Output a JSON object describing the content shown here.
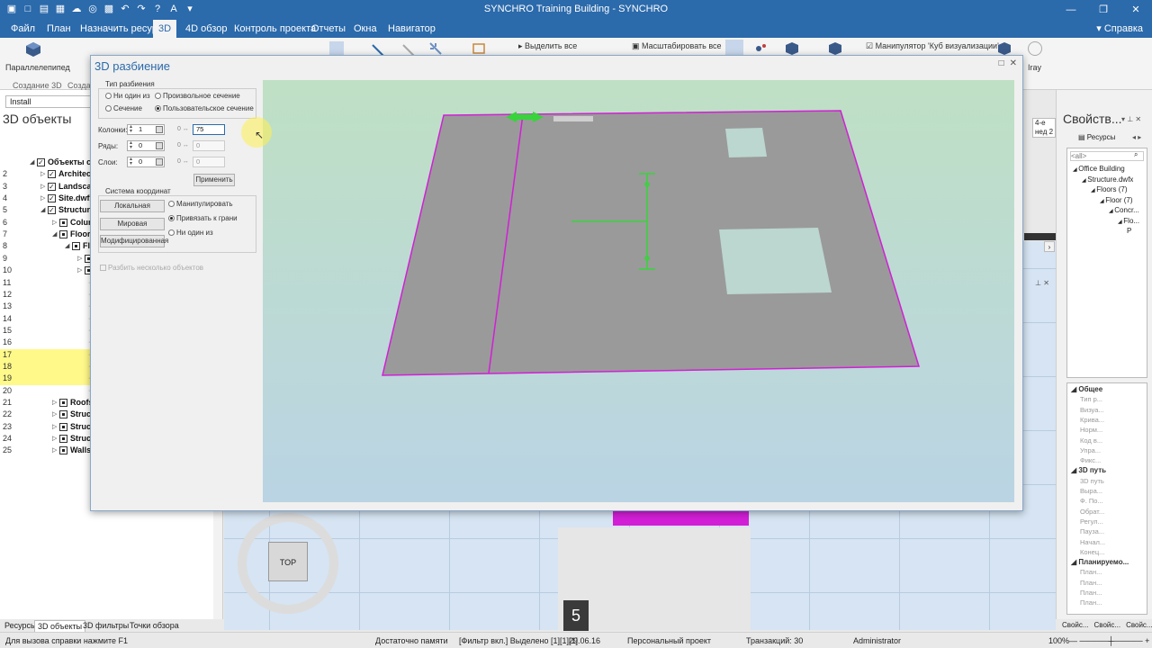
{
  "window": {
    "title": "SYNCHRO Training Building - SYNCHRO",
    "qat_icons": [
      "app-icon",
      "new-icon",
      "open-icon",
      "save-icon",
      "cloud-icon",
      "globe-icon",
      "grid-icon",
      "undo-icon",
      "redo-icon",
      "help-icon",
      "font-icon",
      "more-icon"
    ]
  },
  "menu": {
    "tabs": [
      "Файл",
      "План",
      "Назначить ресурсы",
      "3D",
      "4D обзор",
      "Контроль проекта",
      "Отчеты",
      "Окна",
      "Навигатор"
    ],
    "active": "3D",
    "help": "Справка"
  },
  "ribbon": {
    "items": {
      "parallelepiped": "Параллелепипед",
      "select_all": "Выделить все",
      "zoom_all": "Масштабировать все",
      "manipulator": "Манипулятор 'Куб визуализации'",
      "iray": "Iray"
    },
    "groups": {
      "create3d": "Создание 3D",
      "create_short": "Создан"
    }
  },
  "left_panel": {
    "filter": "Install",
    "title": "3D объекты",
    "rows": [
      {
        "num": "",
        "label": "Объекты сц",
        "level": 0
      },
      {
        "num": "2",
        "label": "Architect",
        "level": 1
      },
      {
        "num": "3",
        "label": "Landscap",
        "level": 1
      },
      {
        "num": "4",
        "label": "Site.dwfx",
        "level": 1
      },
      {
        "num": "5",
        "label": "Structure",
        "level": 1
      },
      {
        "num": "6",
        "label": "Colum",
        "level": 2
      },
      {
        "num": "7",
        "label": "Floors",
        "level": 2
      },
      {
        "num": "8",
        "label": "Fl",
        "level": 3
      },
      {
        "num": "9",
        "label": "",
        "level": 4
      },
      {
        "num": "10",
        "label": "",
        "level": 4
      },
      {
        "num": "11",
        "label": "",
        "level": 5
      },
      {
        "num": "12",
        "label": "",
        "level": 5
      },
      {
        "num": "13",
        "label": "",
        "level": 5
      },
      {
        "num": "14",
        "label": "",
        "level": 5
      },
      {
        "num": "15",
        "label": "",
        "level": 5
      },
      {
        "num": "16",
        "label": "",
        "level": 5
      },
      {
        "num": "17",
        "label": "",
        "level": 5
      },
      {
        "num": "18",
        "label": "",
        "level": 5
      },
      {
        "num": "19",
        "label": "",
        "level": 5
      },
      {
        "num": "20",
        "label": "",
        "level": 5
      },
      {
        "num": "21",
        "label": "Roofs",
        "level": 2
      },
      {
        "num": "22",
        "label": "Struct",
        "level": 2
      },
      {
        "num": "23",
        "label": "Struct",
        "level": 2
      },
      {
        "num": "24",
        "label": "Struct",
        "level": 2
      },
      {
        "num": "25",
        "label": "Walls",
        "level": 2
      }
    ],
    "bottom_tabs": [
      "Ресурсы",
      "3D объекты",
      "3D фильтры",
      "Точки обзора"
    ],
    "active_bottom_tab": "3D объекты"
  },
  "viewport": {
    "top_button": "TOP",
    "counter": "5"
  },
  "right_panel": {
    "title": "Свойств...",
    "side_values": [
      "4-е",
      "нед 2"
    ],
    "resources_tab": "Ресурсы",
    "filter_value": "<all>",
    "tree": [
      "Office Building",
      "Structure.dwfx",
      "Floors (7)",
      "Floor (7)",
      "Concr...",
      "Flo...",
      "P"
    ],
    "prop_groups": [
      {
        "head": "Общее",
        "rows": [
          "Тип р...",
          "Визуа...",
          "Крива...",
          "Норм...",
          "Код в...",
          "Упра...",
          "Фикс..."
        ]
      },
      {
        "head": "3D путь",
        "rows": [
          "3D путь",
          "Выра...",
          "Ф. По...",
          "Обрат...",
          "Регул...",
          "Пауза...",
          "Начал...",
          "Конец..."
        ]
      },
      {
        "head": "Планируемо...",
        "rows": [
          "План...",
          "План...",
          "План...",
          "План..."
        ]
      }
    ],
    "bottom_tabs": [
      "Свойс...",
      "Свойс...",
      "Свойс..."
    ]
  },
  "status": {
    "help": "Для вызова справки нажмите F1",
    "memory": "Достаточно памяти",
    "filter": "[Фильтр вкл.] Выделено [1][1][1]",
    "date": "29.06.16",
    "project": "Персональный проект",
    "transactions": "Транзакций: 30",
    "user": "Administrator",
    "zoom": "100%"
  },
  "dialog": {
    "title": "3D разбиение",
    "split_type_legend": "Тип разбиения",
    "split_types": [
      "Ни один из",
      "Произвольное сечение",
      "Сечение",
      "Пользовательское сечение"
    ],
    "selected_split": "Пользовательское сечение",
    "columns_label": "Колонки:",
    "rows_label": "Ряды:",
    "layers_label": "Слои:",
    "columns_value": "1",
    "rows_value": "0",
    "layers_value": "0",
    "columns_num": "75",
    "rows_num": "0",
    "layers_num": "0",
    "small_zero": "0",
    "apply": "Применить",
    "coord_legend": "Система координат",
    "coord_buttons": [
      "Локальная",
      "Мировая",
      "Модифицированная"
    ],
    "coord_options": [
      "Манипулировать",
      "Привязать к грани",
      "Ни один из"
    ],
    "selected_coord": "Привязать к грани",
    "multi_split": "Разбить несколько объектов"
  }
}
